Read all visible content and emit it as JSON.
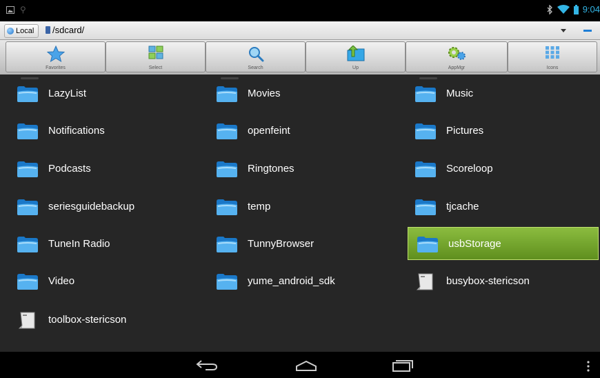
{
  "status": {
    "time": "9:04"
  },
  "address": {
    "location": "Local",
    "path": "/sdcard/"
  },
  "toolbar": {
    "favorites": "Favorites",
    "select": "Select",
    "search": "Search",
    "up": "Up",
    "appmgr": "AppMgr",
    "icons": "Icons"
  },
  "items": [
    {
      "name": "LazyList",
      "type": "folder"
    },
    {
      "name": "Movies",
      "type": "folder"
    },
    {
      "name": "Music",
      "type": "folder"
    },
    {
      "name": "Notifications",
      "type": "folder"
    },
    {
      "name": "openfeint",
      "type": "folder"
    },
    {
      "name": "Pictures",
      "type": "folder"
    },
    {
      "name": "Podcasts",
      "type": "folder"
    },
    {
      "name": "Ringtones",
      "type": "folder"
    },
    {
      "name": "Scoreloop",
      "type": "folder"
    },
    {
      "name": "seriesguidebackup",
      "type": "folder"
    },
    {
      "name": "temp",
      "type": "folder"
    },
    {
      "name": "tjcache",
      "type": "folder"
    },
    {
      "name": "TuneIn Radio",
      "type": "folder"
    },
    {
      "name": "TunnyBrowser",
      "type": "folder"
    },
    {
      "name": "usbStorage",
      "type": "folder",
      "selected": true
    },
    {
      "name": "Video",
      "type": "folder"
    },
    {
      "name": "yume_android_sdk",
      "type": "folder"
    },
    {
      "name": "busybox-stericson",
      "type": "file"
    },
    {
      "name": "toolbox-stericson",
      "type": "file"
    }
  ],
  "colors": {
    "accent": "#33b5e5",
    "selected": "#7aab2e",
    "background": "#262626"
  }
}
